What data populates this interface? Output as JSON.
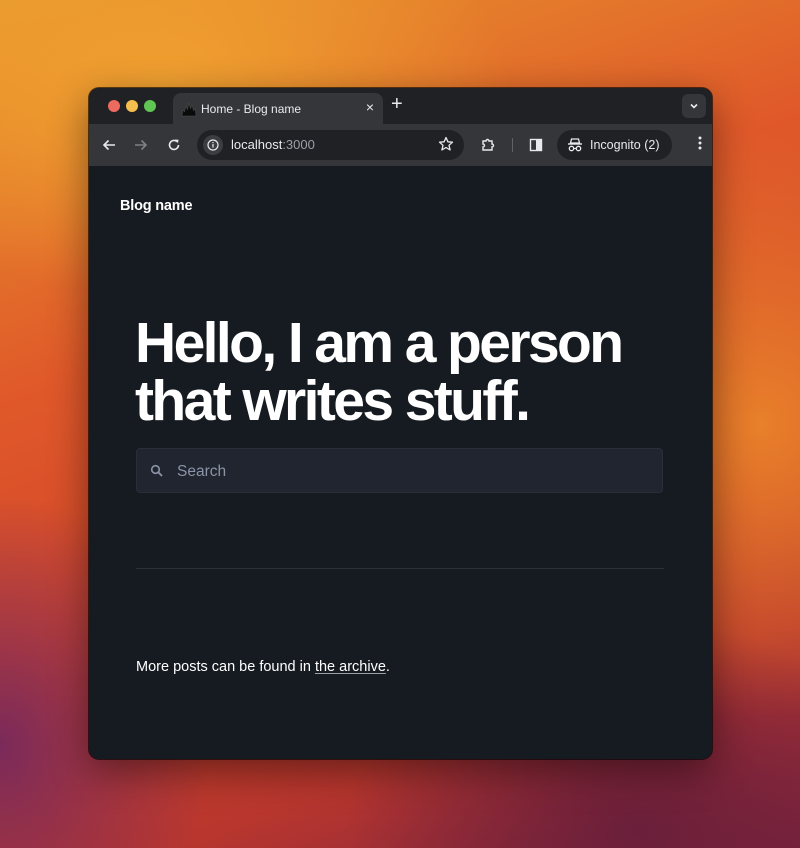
{
  "browser": {
    "tab": {
      "title": "Home - Blog name",
      "favicon": "flame-logo-icon"
    },
    "new_tab_label": "+",
    "close_tab_label": "×",
    "address_bar": {
      "host": "localhost",
      "port": ":3000"
    },
    "incognito": {
      "label": "Incognito (2)"
    }
  },
  "page": {
    "site_title": "Blog name",
    "hero_line1": "Hello, I am a person",
    "hero_line2": "that writes stuff.",
    "search": {
      "placeholder": "Search",
      "value": ""
    },
    "footer_text_before": "More posts can be found in ",
    "footer_link": "the archive",
    "footer_text_after": "."
  }
}
